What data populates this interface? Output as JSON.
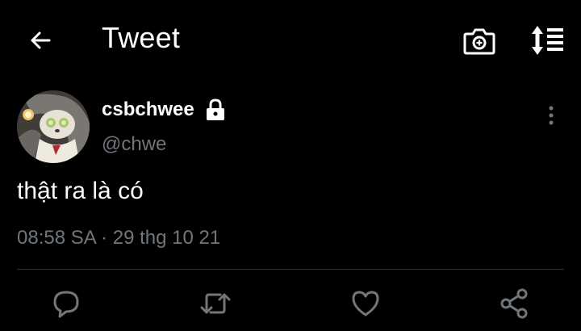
{
  "header": {
    "title": "Tweet",
    "icons": [
      "arrow-left-icon",
      "camera-icon",
      "sort-icon"
    ]
  },
  "tweet": {
    "display_name": "csbchwee",
    "handle": "@chwe",
    "text": "thật ra là có",
    "time": "08:58 SA",
    "separator": " · ",
    "date": "29 thg 10 21"
  },
  "actions": [
    "reply-icon",
    "retweet-icon",
    "like-icon",
    "share-icon"
  ],
  "colors": {
    "background": "#000000",
    "primary_text": "#ffffff",
    "secondary_text": "#71767b",
    "divider": "#2f3336"
  }
}
